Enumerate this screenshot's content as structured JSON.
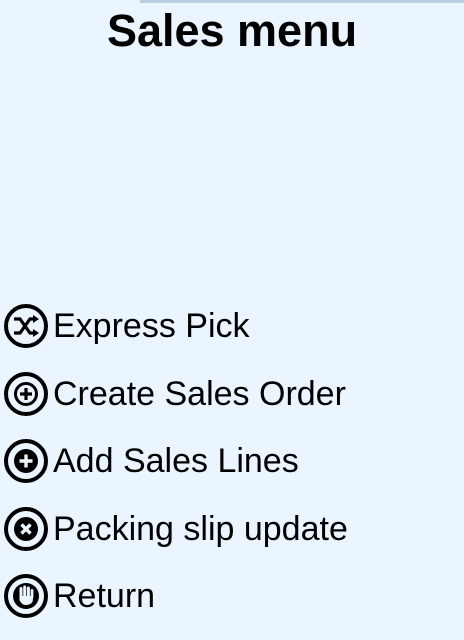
{
  "screen": {
    "title": "Sales menu"
  },
  "menu": {
    "items": [
      {
        "label": "Express Pick",
        "icon": "shuffle-icon"
      },
      {
        "label": "Create Sales Order",
        "icon": "plus-circle-icon"
      },
      {
        "label": "Add Sales Lines",
        "icon": "plus-filled-icon"
      },
      {
        "label": "Packing slip update",
        "icon": "x-circle-icon"
      },
      {
        "label": "Return",
        "icon": "stop-hand-icon"
      }
    ]
  },
  "colors": {
    "background": "#eaf5ff",
    "text": "#000000"
  }
}
